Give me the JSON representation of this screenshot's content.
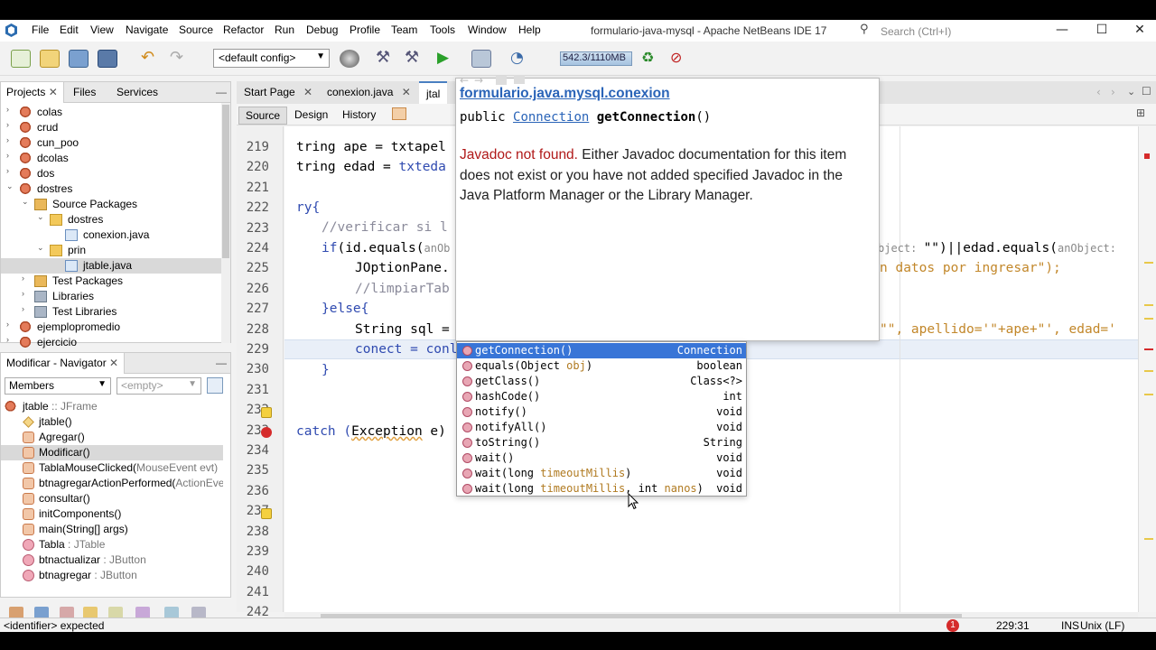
{
  "menu": {
    "items": [
      "File",
      "Edit",
      "View",
      "Navigate",
      "Source",
      "Refactor",
      "Run",
      "Debug",
      "Profile",
      "Team",
      "Tools",
      "Window",
      "Help"
    ],
    "window_title": "formulario-java-mysql - Apache NetBeans IDE 17",
    "search_placeholder": "Search (Ctrl+I)"
  },
  "toolbar": {
    "config": "<default config>",
    "memory": "542.3/1110MB"
  },
  "projects": {
    "tabs": [
      "Projects",
      "Files",
      "Services"
    ],
    "tree": [
      {
        "label": "colas",
        "level": 0,
        "expand": "›",
        "icon": "coffee-cup-icon"
      },
      {
        "label": "crud",
        "level": 0,
        "expand": "›",
        "icon": "coffee-cup-icon"
      },
      {
        "label": "cun_poo",
        "level": 0,
        "expand": "›",
        "icon": "coffee-cup-icon"
      },
      {
        "label": "dcolas",
        "level": 0,
        "expand": "›",
        "icon": "coffee-cup-icon"
      },
      {
        "label": "dos",
        "level": 0,
        "expand": "›",
        "icon": "coffee-cup-icon"
      },
      {
        "label": "dostres",
        "level": 0,
        "expand": "⌄",
        "icon": "coffee-cup-icon"
      },
      {
        "label": "Source Packages",
        "level": 1,
        "expand": "⌄",
        "icon": "folder-icon"
      },
      {
        "label": "dostres",
        "level": 2,
        "expand": "⌄",
        "icon": "package-icon"
      },
      {
        "label": "conexion.java",
        "level": 3,
        "expand": "",
        "icon": "java-file-icon"
      },
      {
        "label": "prin",
        "level": 2,
        "expand": "⌄",
        "icon": "package-icon"
      },
      {
        "label": "jtable.java",
        "level": 3,
        "expand": "",
        "icon": "java-file-icon"
      },
      {
        "label": "Test Packages",
        "level": 1,
        "expand": "›",
        "icon": "folder-icon"
      },
      {
        "label": "Libraries",
        "level": 1,
        "expand": "›",
        "icon": "library-icon"
      },
      {
        "label": "Test Libraries",
        "level": 1,
        "expand": "›",
        "icon": "library-icon"
      },
      {
        "label": "ejemplopromedio",
        "level": 0,
        "expand": "›",
        "icon": "coffee-cup-icon"
      },
      {
        "label": "ejercicio",
        "level": 0,
        "expand": "›",
        "icon": "coffee-cup-icon"
      }
    ]
  },
  "navigator": {
    "title": "Modificar - Navigator",
    "filter": "Members",
    "empty": "<empty>",
    "class_label": "jtable",
    "class_type": " :: JFrame",
    "members": [
      {
        "name": "jtable()",
        "type": "",
        "kind": "constructor"
      },
      {
        "name": "Agregar()",
        "type": "",
        "kind": "method"
      },
      {
        "name": "Modificar()",
        "type": "",
        "kind": "method"
      },
      {
        "name": "TablaMouseClicked(",
        "type": "MouseEvent evt)",
        "kind": "method"
      },
      {
        "name": "btnagregarActionPerformed(",
        "type": "ActionEvent",
        "kind": "method"
      },
      {
        "name": "consultar()",
        "type": "",
        "kind": "method"
      },
      {
        "name": "initComponents()",
        "type": "",
        "kind": "method"
      },
      {
        "name": "main(String[] args)",
        "type": "",
        "kind": "static-method"
      },
      {
        "name": "Tabla",
        "type": " : JTable",
        "kind": "field"
      },
      {
        "name": "btnactualizar",
        "type": " : JButton",
        "kind": "field"
      },
      {
        "name": "btnagregar",
        "type": " : JButton",
        "kind": "field"
      }
    ]
  },
  "editor": {
    "tabs": [
      "Start Page",
      "conexion.java",
      "jtal"
    ],
    "views": [
      "Source",
      "Design",
      "History"
    ],
    "line_numbers": [
      "219",
      "220",
      "221",
      "222",
      "223",
      "224",
      "225",
      "226",
      "227",
      "228",
      "229",
      "230",
      "231",
      "232",
      "233",
      "234",
      "235",
      "236",
      "237",
      "238",
      "239",
      "240",
      "241",
      "242"
    ],
    "code": {
      "l219": "tring ape = txtapel",
      "l220a": "tring edad = ",
      "l220b": "txteda",
      "l222": "ry{",
      "l223": "//verificar si l",
      "l224a": "if",
      "l224b": "(id.equals(",
      "l224c": "anOb",
      "l224d": "bject: ",
      "l224e": "\"\")||edad.equals(",
      "l224f": "anObject: ",
      "l225a": "JOptionPane.",
      "l225b": "n datos por ingresar\");",
      "l226": "//limpiarTab",
      "l227": "}else{",
      "l228a": "String sql = ",
      "l228b": "\"\", apellido='\"+ape+\"', edad='",
      "l229a": "conect = conl.g",
      "l230": "}",
      "l233a": "catch (",
      "l233b": "Exception",
      "l233c": " e)"
    }
  },
  "javadoc": {
    "title": "formulario.java.mysql.conexion",
    "sig_public": "public ",
    "sig_type": "Connection",
    "sig_method": "getConnection",
    "sig_parens": "()",
    "body_red": "Javadoc not found.",
    "body_rest": " Either Javadoc documentation for this item does not exist or you have not added specified Javadoc in the Java Platform Manager or the Library Manager."
  },
  "completion": {
    "items": [
      {
        "name": "getConnection()",
        "params": "",
        "type": "Connection",
        "selected": true
      },
      {
        "name": "equals(Object ",
        "params": "obj",
        "tail": ")",
        "type": "boolean"
      },
      {
        "name": "getClass()",
        "params": "",
        "type": "Class<?>"
      },
      {
        "name": "hashCode()",
        "params": "",
        "type": "int"
      },
      {
        "name": "notify()",
        "params": "",
        "type": "void"
      },
      {
        "name": "notifyAll()",
        "params": "",
        "type": "void"
      },
      {
        "name": "toString()",
        "params": "",
        "type": "String"
      },
      {
        "name": "wait()",
        "params": "",
        "type": "void"
      },
      {
        "name": "wait(long ",
        "params": "timeoutMillis",
        "tail": ")",
        "type": "void"
      },
      {
        "name": "wait(long ",
        "params": "timeoutMillis",
        "tail": ", int ",
        "params2": "nanos",
        "tail2": ")",
        "type": "void"
      }
    ]
  },
  "status": {
    "message": "<identifier> expected",
    "errors": "1",
    "position": "229:31",
    "mode": "INS",
    "line_endings": "Unix (LF)"
  },
  "colors": {
    "accent": "#2a64b8",
    "selection": "#3875d7",
    "error": "#d52b2b"
  }
}
